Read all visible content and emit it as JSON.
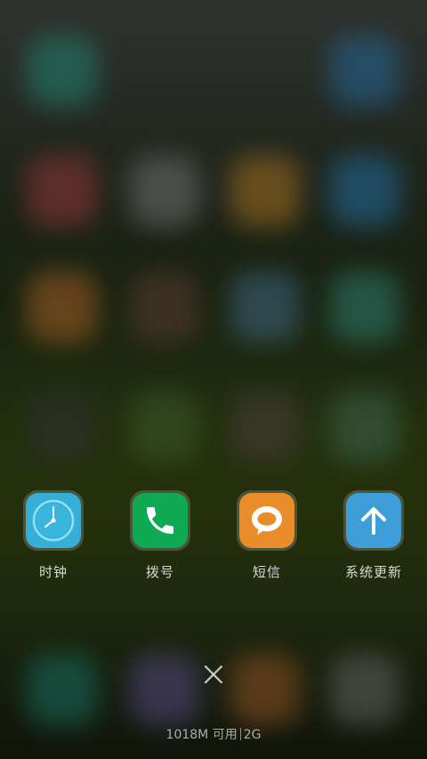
{
  "recent_apps": [
    {
      "label": "时钟",
      "icon": "clock-icon",
      "color": "#3ab0d8"
    },
    {
      "label": "拨号",
      "icon": "phone-icon",
      "color": "#0fa853"
    },
    {
      "label": "短信",
      "icon": "message-icon",
      "color": "#e98d2a"
    },
    {
      "label": "系统更新",
      "icon": "arrow-up-icon",
      "color": "#3e9fd8"
    }
  ],
  "close": {
    "icon": "close-icon"
  },
  "memory": {
    "available": "1018M 可用",
    "total": "2G"
  }
}
